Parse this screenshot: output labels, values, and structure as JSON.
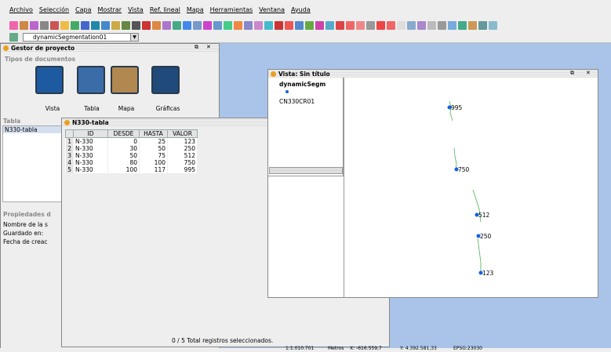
{
  "menu": [
    "Archivo",
    "Selección",
    "Capa",
    "Mostrar",
    "Vista",
    "Ref. lineal",
    "Mapa",
    "Herramientas",
    "Ventana",
    "Ayuda"
  ],
  "layer_combo": "dynamicSegmentation01",
  "project": {
    "title": "Gestor de proyecto",
    "doc_types_label": "Tipos de documentos",
    "docs": [
      "Vista",
      "Tabla",
      "Mapa",
      "Gráficas"
    ],
    "tabla_section": "Tabla",
    "tabla_item": "N330-tabla",
    "props_label": "Propiedades d",
    "props": [
      "Nombre de la s",
      "Guardado en:",
      "Fecha de creac"
    ]
  },
  "table_window": {
    "title": "N330-tabla",
    "columns": [
      "ID",
      "DESDE",
      "HASTA",
      "VALOR"
    ],
    "rows": [
      [
        "1",
        "N-330",
        "0",
        "25",
        "123"
      ],
      [
        "2",
        "N-330",
        "30",
        "50",
        "250"
      ],
      [
        "3",
        "N-330",
        "50",
        "75",
        "512"
      ],
      [
        "4",
        "N-330",
        "80",
        "100",
        "750"
      ],
      [
        "5",
        "N-330",
        "100",
        "117",
        "995"
      ]
    ],
    "status": "0 / 5 Total registros seleccionados."
  },
  "vista": {
    "title": "Vista: Sin título",
    "layers": [
      "dynamicSegm",
      "CN330CR01"
    ],
    "labels": [
      "995",
      "750",
      "512",
      "250",
      "123"
    ]
  },
  "bottom": {
    "scale": "1:1.010.701",
    "units": "Metros",
    "x": "X: -616.559,7",
    "y": "Y: 4.392.581,33",
    "srs": "EPSG:23030"
  }
}
